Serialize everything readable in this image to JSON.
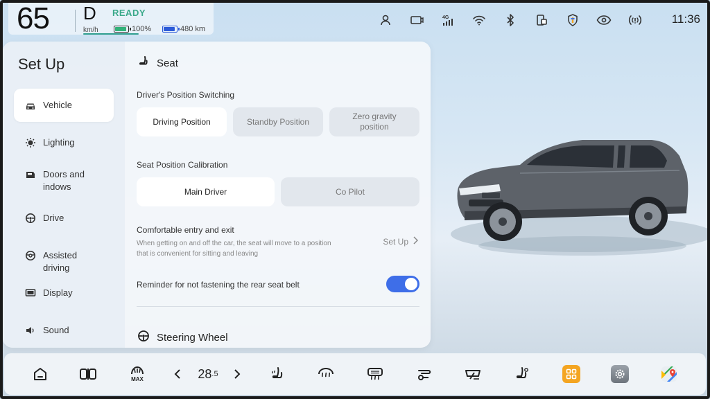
{
  "status": {
    "speed": "65",
    "speed_unit": "km/h",
    "gear": "D",
    "ready": "READY",
    "battery_percent": "100%",
    "battery_level": 1.0,
    "range": "480 km",
    "range_level": 1.0,
    "time": "11:36",
    "icons": [
      "person-icon",
      "dashcam-icon",
      "signal-4g-icon",
      "wifi-icon",
      "bluetooth-icon",
      "phone-mirror-icon",
      "shield-icon",
      "eye-icon",
      "broadcast-icon"
    ],
    "network_label": "4G"
  },
  "sidebar": {
    "title": "Set Up",
    "items": [
      {
        "label": "Vehicle",
        "icon": "car-icon",
        "active": true
      },
      {
        "label": "Lighting",
        "icon": "light-icon"
      },
      {
        "label": "Doors and\nindows",
        "icon": "door-icon"
      },
      {
        "label": "Drive",
        "icon": "steering-icon"
      },
      {
        "label": "Assisted\ndriving",
        "icon": "assist-icon"
      },
      {
        "label": "Display",
        "icon": "display-icon"
      },
      {
        "label": "Sound",
        "icon": "speaker-icon"
      }
    ]
  },
  "content": {
    "seat_title": "Seat",
    "position_switching_label": "Driver's Position Switching",
    "position_options": [
      "Driving Position",
      "Standby Position",
      "Zero gravity\nposition"
    ],
    "calibration_label": "Seat Position Calibration",
    "calibration_options": [
      "Main Driver",
      "Co Pilot"
    ],
    "comfort_label": "Comfortable entry and exit",
    "comfort_desc": "When getting on and off the car, the seat will move to a position that is convenient for sitting and leaving",
    "comfort_link": "Set Up",
    "reminder_label": "Reminder for not fastening the rear seat belt",
    "reminder_on": true,
    "steering_title": "Steering Wheel"
  },
  "dock": {
    "temperature": "28",
    "temperature_decimal": ".5",
    "max_label": "MAX",
    "colors": {
      "accent": "#f4a522",
      "toggle": "#3e6ee8",
      "ready": "#3aa98a"
    }
  }
}
